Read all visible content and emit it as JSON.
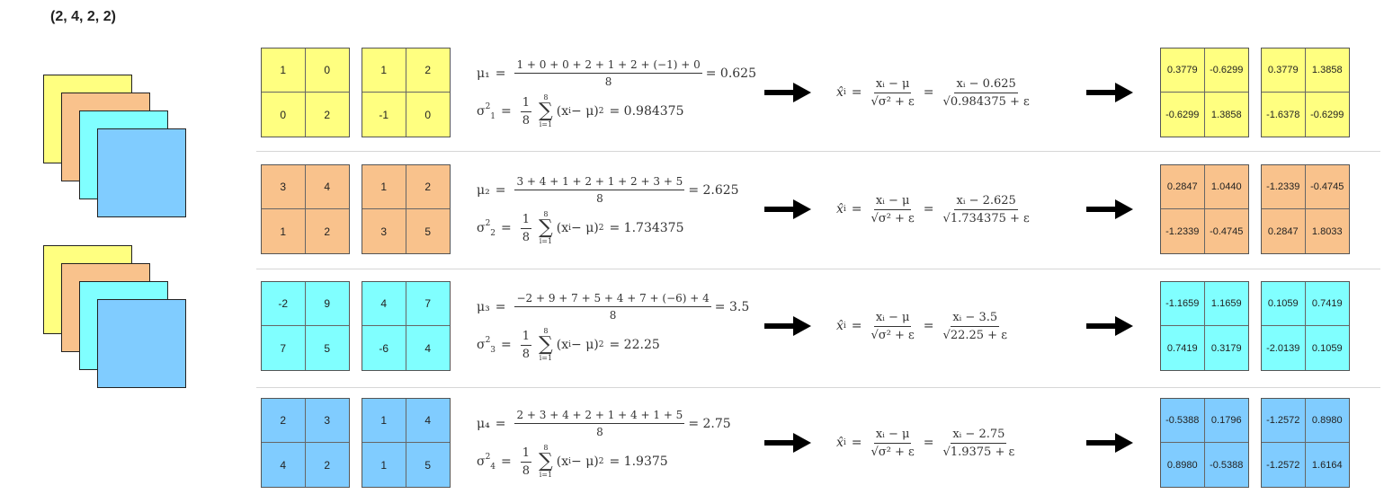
{
  "shape_label": "(2, 4, 2, 2)",
  "colors": [
    "#ffff80",
    "#f9c28c",
    "#80ffff",
    "#80ccff"
  ],
  "rows": [
    {
      "mean_label": "μ₁",
      "index": "1",
      "mean_numerator": "1 + 0 + 0 + 2 + 1 + 2 + (−1) + 0",
      "mean_denominator": "8",
      "mean_value": "= 0.625",
      "variance_value": "= 0.984375",
      "norm_mu": "0.625",
      "norm_var": "0.984375",
      "input_a": [
        "1",
        "0",
        "0",
        "2"
      ],
      "input_b": [
        "1",
        "2",
        "-1",
        "0"
      ],
      "output_a": [
        "0.3779",
        "-0.6299",
        "-0.6299",
        "1.3858"
      ],
      "output_b": [
        "0.3779",
        "1.3858",
        "-1.6378",
        "-0.6299"
      ]
    },
    {
      "mean_label": "μ₂",
      "index": "2",
      "mean_numerator": "3 + 4 + 1 + 2 + 1 + 2 + 3 + 5",
      "mean_denominator": "8",
      "mean_value": "= 2.625",
      "variance_value": "= 1.734375",
      "norm_mu": "2.625",
      "norm_var": "1.734375",
      "input_a": [
        "3",
        "4",
        "1",
        "2"
      ],
      "input_b": [
        "1",
        "2",
        "3",
        "5"
      ],
      "output_a": [
        "0.2847",
        "1.0440",
        "-1.2339",
        "-0.4745"
      ],
      "output_b": [
        "-1.2339",
        "-0.4745",
        "0.2847",
        "1.8033"
      ]
    },
    {
      "mean_label": "μ₃",
      "index": "3",
      "mean_numerator": "−2 + 9 + 7 + 5 + 4 + 7 + (−6) + 4",
      "mean_denominator": "8",
      "mean_value": "= 3.5",
      "variance_value": "= 22.25",
      "norm_mu": "3.5",
      "norm_var": "22.25",
      "input_a": [
        "-2",
        "9",
        "7",
        "5"
      ],
      "input_b": [
        "4",
        "7",
        "-6",
        "4"
      ],
      "output_a": [
        "-1.1659",
        "1.1659",
        "0.7419",
        "0.3179"
      ],
      "output_b": [
        "0.1059",
        "0.7419",
        "-2.0139",
        "0.1059"
      ]
    },
    {
      "mean_label": "μ₄",
      "index": "4",
      "mean_numerator": "2 + 3 + 4 + 2 + 1 + 4 + 1 + 5",
      "mean_denominator": "8",
      "mean_value": "= 2.75",
      "variance_value": "= 1.9375",
      "norm_mu": "2.75",
      "norm_var": "1.9375",
      "input_a": [
        "2",
        "3",
        "4",
        "2"
      ],
      "input_b": [
        "1",
        "4",
        "1",
        "5"
      ],
      "output_a": [
        "-0.5388",
        "0.1796",
        "0.8980",
        "-0.5388"
      ],
      "output_b": [
        "-1.2572",
        "0.8980",
        "-1.2572",
        "1.6164"
      ]
    }
  ]
}
